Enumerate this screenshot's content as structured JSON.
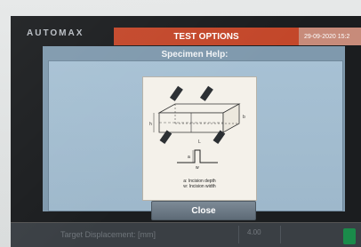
{
  "header": {
    "brand": "AUTOMAX",
    "title": "TEST OPTIONS",
    "datetime": "29-09-2020 15:2"
  },
  "dialog": {
    "title": "Specimen Help:",
    "legend_line1": "a: Incision depth",
    "legend_line2": "w: Incision width",
    "close_label": "Close"
  },
  "footer": {
    "label": "Target Displacement: [mm]",
    "value": "4.00"
  }
}
